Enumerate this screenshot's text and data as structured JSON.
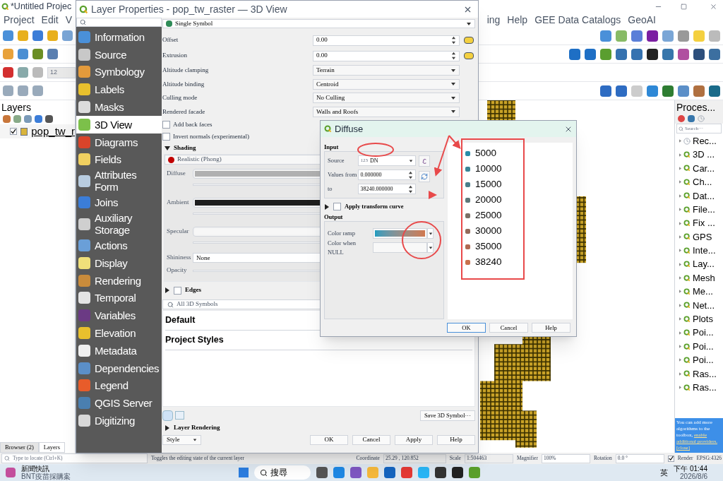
{
  "main_window": {
    "title": "*Untitled Projec",
    "menu_left": [
      "Project",
      "Edit",
      "V"
    ],
    "menu_right": [
      "ing",
      "Help",
      "GEE Data Catalogs",
      "GeoAI"
    ],
    "snap_value": "12"
  },
  "layers_panel": {
    "title": "Layers",
    "layers": [
      {
        "name": "pop_tw_r",
        "checked": true,
        "color": "#d9b43c"
      }
    ],
    "tabs": [
      {
        "label": "Browser (2)",
        "selected": false
      },
      {
        "label": "Layers",
        "selected": true
      }
    ],
    "locate_placeholder": "Type to locate (Ctrl+K)"
  },
  "processing": {
    "title": "Proces...",
    "search_placeholder": "Search···",
    "items": [
      {
        "label": "Rec...",
        "kind": "recent"
      },
      {
        "label": "3D ...",
        "kind": "provider"
      },
      {
        "label": "Car...",
        "kind": "provider"
      },
      {
        "label": "Ch...",
        "kind": "provider"
      },
      {
        "label": "Dat...",
        "kind": "provider"
      },
      {
        "label": "File...",
        "kind": "provider"
      },
      {
        "label": "Fix ...",
        "kind": "provider"
      },
      {
        "label": "GPS",
        "kind": "provider"
      },
      {
        "label": "Inte...",
        "kind": "provider"
      },
      {
        "label": "Lay...",
        "kind": "provider"
      },
      {
        "label": "Mesh",
        "kind": "provider"
      },
      {
        "label": "Me...",
        "kind": "provider"
      },
      {
        "label": "Net...",
        "kind": "provider"
      },
      {
        "label": "Plots",
        "kind": "provider"
      },
      {
        "label": "Poi...",
        "kind": "provider"
      },
      {
        "label": "Poi...",
        "kind": "provider"
      },
      {
        "label": "Poi...",
        "kind": "provider"
      },
      {
        "label": "Ras...",
        "kind": "provider"
      },
      {
        "label": "Ras...",
        "kind": "provider"
      }
    ],
    "notice": {
      "text": "You can add more algorithms to the toolbox, ",
      "link": "enable additional providers.",
      "close": "[close]"
    }
  },
  "status_bar": {
    "message": "Toggles the editing state of the current layer",
    "coordinate_label": "Coordinate",
    "coordinate": "25.29 , 120.852",
    "scale_label": "Scale",
    "scale": "1:504463",
    "magnifier_label": "Magnifier",
    "magnifier": "100%",
    "rotation_label": "Rotation",
    "rotation": "0.0 °",
    "render_label": "Render",
    "render": true,
    "crs": "EPSG:4326"
  },
  "layer_properties": {
    "title": "Layer Properties - pop_tw_raster — 3D View",
    "nav": [
      {
        "label": "Information",
        "selected": false
      },
      {
        "label": "Source",
        "selected": false
      },
      {
        "label": "Symbology",
        "selected": false
      },
      {
        "label": "Labels",
        "selected": false
      },
      {
        "label": "Masks",
        "selected": false
      },
      {
        "label": "3D View",
        "selected": true
      },
      {
        "label": "Diagrams",
        "selected": false
      },
      {
        "label": "Fields",
        "selected": false
      },
      {
        "label": "Attributes Form",
        "selected": false
      },
      {
        "label": "Joins",
        "selected": false
      },
      {
        "label": "Auxiliary Storage",
        "selected": false
      },
      {
        "label": "Actions",
        "selected": false
      },
      {
        "label": "Display",
        "selected": false
      },
      {
        "label": "Rendering",
        "selected": false
      },
      {
        "label": "Temporal",
        "selected": false
      },
      {
        "label": "Variables",
        "selected": false
      },
      {
        "label": "Elevation",
        "selected": false
      },
      {
        "label": "Metadata",
        "selected": false
      },
      {
        "label": "Dependencies",
        "selected": false
      },
      {
        "label": "Legend",
        "selected": false
      },
      {
        "label": "QGIS Server",
        "selected": false
      },
      {
        "label": "Digitizing",
        "selected": false
      }
    ],
    "symbol_type": "Single Symbol",
    "fields": [
      {
        "label": "Offset",
        "value": "0.00",
        "kind": "spin"
      },
      {
        "label": "Extrusion",
        "value": "0.00",
        "kind": "spin"
      },
      {
        "label": "Altitude clamping",
        "value": "Terrain",
        "kind": "combo"
      },
      {
        "label": "Altitude binding",
        "value": "Centroid",
        "kind": "combo"
      },
      {
        "label": "Culling mode",
        "value": "No Culling",
        "kind": "combo"
      },
      {
        "label": "Rendered facade",
        "value": "Walls and Roofs",
        "kind": "combo"
      }
    ],
    "options": [
      {
        "label": "Add back faces",
        "checked": false
      },
      {
        "label": "Invert normals (experimental)",
        "checked": false
      }
    ],
    "shading": {
      "title": "Shading",
      "expanded": true,
      "technique": "Realistic (Phong)",
      "colors": [
        {
          "label": "Diffuse",
          "color": "#b0b0b0"
        },
        {
          "label": "Ambient",
          "color": "#1e1e1e"
        },
        {
          "label": "Specular",
          "color": "#f7f7f7"
        }
      ],
      "shininess_label": "Shininess",
      "shininess": "None",
      "opacity_label": "Opacity"
    },
    "edges": {
      "title": "Edges",
      "checked": false,
      "expanded": false
    },
    "symbol_search_placeholder": "All 3D Symbols",
    "symbol_groups": [
      "Default",
      "Project Styles"
    ],
    "save_button": "Save 3D Symbol···",
    "layer_rendering": "Layer Rendering",
    "style_button": "Style",
    "buttons": [
      "OK",
      "Cancel",
      "Apply",
      "Help"
    ]
  },
  "diffuse": {
    "title": "Diffuse",
    "input_title": "Input",
    "source_label": "Source",
    "source_type": "123",
    "source": "DN",
    "from_label": "Values from",
    "from": "0.000000",
    "to_label": "to",
    "to": "38240.000000",
    "transform": {
      "label": "Apply transform curve",
      "checked": false
    },
    "output_title": "Output",
    "ramp_label": "Color ramp",
    "null_label": "Color when NULL",
    "legend": [
      {
        "label": "5000",
        "color": "#2a8ca8"
      },
      {
        "label": "10000",
        "color": "#3a8496"
      },
      {
        "label": "15000",
        "color": "#4a7d8a"
      },
      {
        "label": "20000",
        "color": "#5e7778"
      },
      {
        "label": "25000",
        "color": "#7a6f66"
      },
      {
        "label": "30000",
        "color": "#946a5a"
      },
      {
        "label": "35000",
        "color": "#b06852"
      },
      {
        "label": "38240",
        "color": "#c8704c"
      }
    ],
    "buttons": [
      "OK",
      "Cancel",
      "Help"
    ]
  },
  "taskbar": {
    "news_title": "新聞快訊",
    "news_text": "BNT疫苗採購案",
    "search": "搜尋",
    "ime": "英",
    "time": "下午 01:44",
    "date": "2026/8/6"
  }
}
